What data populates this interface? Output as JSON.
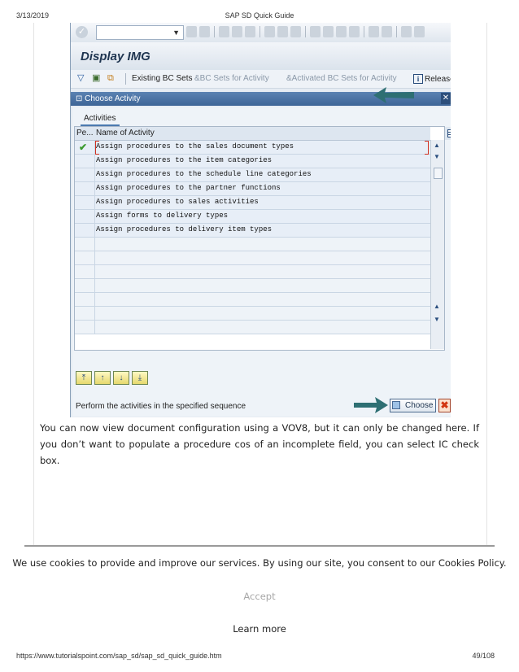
{
  "page_header": {
    "date": "3/13/2019",
    "title": "SAP SD Quick Guide"
  },
  "page_footer": {
    "url": "https://www.tutorialspoint.com/sap_sd/sap_sd_quick_guide.htm",
    "page": "49/108"
  },
  "sap": {
    "window_title": "Display IMG",
    "toolbar": {
      "existing_bc_sets": "Existing BC Sets",
      "bc_sets_for_activity": "BC Sets for Activity",
      "activated_bc_sets": "Activated BC Sets for Activity",
      "release": "Release"
    },
    "dialog": {
      "title": "Choose Activity",
      "tab": "Activities",
      "columns": {
        "pe": "Pe...",
        "name": "Name of Activity"
      },
      "activities": [
        {
          "name": "Assign procedures to the sales document types",
          "done": true
        },
        {
          "name": "Assign procedures to the item categories",
          "done": false
        },
        {
          "name": "Assign procedures to the schedule line categories",
          "done": false
        },
        {
          "name": "Assign procedures to the partner functions",
          "done": false
        },
        {
          "name": "Assign procedures to sales activities",
          "done": false
        },
        {
          "name": "Assign forms to delivery types",
          "done": false
        },
        {
          "name": "Assign procedures to delivery item types",
          "done": false
        }
      ],
      "hint": "Perform the activities in the specified sequence",
      "choose_label": "Choose"
    }
  },
  "article": {
    "paragraph": "You can now view document configuration using a VOV8, but it can only be changed here. If you don’t want to populate a procedure cos of an incomplete field, you can select IC check box."
  },
  "cookie_banner": {
    "message": "We use cookies to provide and improve our services. By using our site, you consent to our Cookies Policy.",
    "accept_label": "Accept",
    "learn_more_label": "Learn more"
  },
  "colors": {
    "sap_dialog_title": "#3d6597",
    "arrow": "#2e6f73",
    "check": "#3c9a2f"
  }
}
